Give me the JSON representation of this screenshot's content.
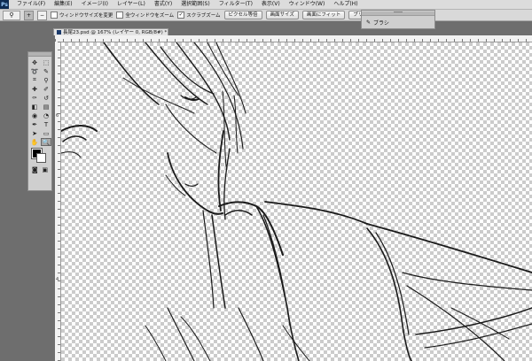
{
  "app": {
    "logo": "Ps"
  },
  "menu": [
    "ファイル(F)",
    "編集(E)",
    "イメージ(I)",
    "レイヤー(L)",
    "書式(Y)",
    "選択範囲(S)",
    "フィルター(T)",
    "表示(V)",
    "ウィンドウ(W)",
    "ヘルプ(H)"
  ],
  "options": {
    "tool_icon": "zoom-icon",
    "zoom_in_symbol": "+",
    "zoom_out_symbol": "−",
    "resize_windows_label": "ウィンドウサイズを変更",
    "zoom_all_windows_label": "全ウィンドウをズーム",
    "scrubby_zoom_label": "スクラブズーム",
    "scrubby_zoom_checked": true,
    "actual_pixels_label": "ピクセル等倍",
    "fit_screen_label": "画面サイズ",
    "fill_screen_label": "画面にフィット",
    "print_size_label": "プリントサイズ"
  },
  "brush_panel": {
    "label": "ブラシ",
    "icon": "brush-icon"
  },
  "document": {
    "tab_label": "長尾23.psd @ 167% (レイヤー 0, RGB/8#) *"
  },
  "rulers": {
    "left_marker": "6",
    "top_marker": "4"
  },
  "toolbox": {
    "tools": [
      {
        "name": "move-tool-icon",
        "glyph": "✥"
      },
      {
        "name": "marquee-tool-icon",
        "glyph": "⬚"
      },
      {
        "name": "lasso-tool-icon",
        "glyph": "➰"
      },
      {
        "name": "quick-select-tool-icon",
        "glyph": "✎"
      },
      {
        "name": "crop-tool-icon",
        "glyph": "⌗"
      },
      {
        "name": "eyedropper-tool-icon",
        "glyph": "⚲"
      },
      {
        "name": "healing-tool-icon",
        "glyph": "✚"
      },
      {
        "name": "brush-tool-icon",
        "glyph": "✐"
      },
      {
        "name": "stamp-tool-icon",
        "glyph": "⚰"
      },
      {
        "name": "history-brush-tool-icon",
        "glyph": "↺"
      },
      {
        "name": "eraser-tool-icon",
        "glyph": "◧"
      },
      {
        "name": "gradient-tool-icon",
        "glyph": "▤"
      },
      {
        "name": "blur-tool-icon",
        "glyph": "◉"
      },
      {
        "name": "dodge-tool-icon",
        "glyph": "◔"
      },
      {
        "name": "pen-tool-icon",
        "glyph": "✒"
      },
      {
        "name": "type-tool-icon",
        "glyph": "T"
      },
      {
        "name": "path-select-tool-icon",
        "glyph": "➤"
      },
      {
        "name": "shape-tool-icon",
        "glyph": "▭"
      },
      {
        "name": "hand-tool-icon",
        "glyph": "✋"
      },
      {
        "name": "zoom-tool-icon",
        "glyph": "🔍"
      }
    ],
    "active_tool": "zoom-tool-icon",
    "foreground_color": "#000000",
    "background_color": "#ffffff"
  }
}
